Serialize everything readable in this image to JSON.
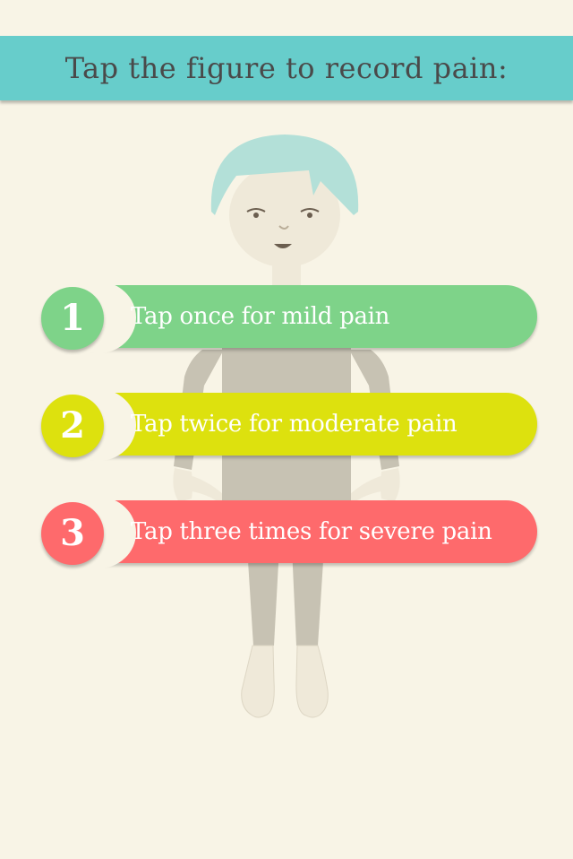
{
  "header": {
    "title": "Tap the figure to record pain:"
  },
  "figure": {
    "icon": "body-figure",
    "hair_color": "#b3e0d8",
    "body_color": "#c7c2b3",
    "skin_color": "#efe9d9"
  },
  "steps": [
    {
      "number": "1",
      "label": "Tap once for mild pain",
      "color": "#7ed389"
    },
    {
      "number": "2",
      "label": "Tap twice for moderate pain",
      "color": "#dde10e"
    },
    {
      "number": "3",
      "label": "Tap three times  for severe pain",
      "color": "#fe6a6c"
    }
  ]
}
